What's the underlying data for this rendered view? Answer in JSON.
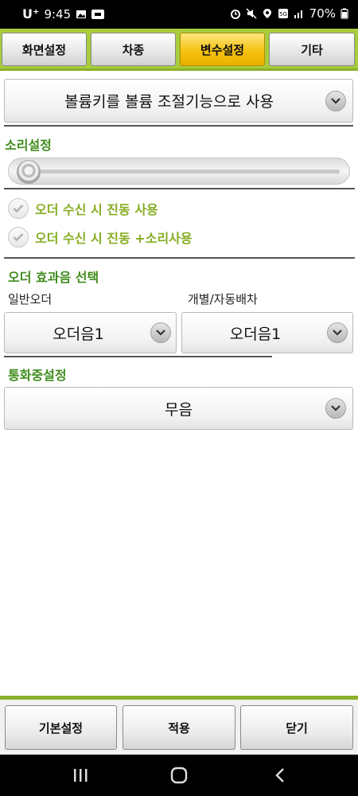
{
  "status_bar": {
    "carrier": "U⁺",
    "time": "9:45",
    "battery": "70%",
    "left_icons": [
      "gallery-icon",
      "notification-badge-icon"
    ],
    "right_icons": [
      "alarm-icon",
      "mute-icon",
      "location-icon",
      "5g-icon",
      "signal-icon",
      "battery-icon"
    ]
  },
  "tabs": [
    {
      "label": "화면설정",
      "active": false
    },
    {
      "label": "차종",
      "active": false
    },
    {
      "label": "변수설정",
      "active": true
    },
    {
      "label": "기타",
      "active": false
    }
  ],
  "volume_key": {
    "selected": "볼륨키를 볼륨 조절기능으로 사용"
  },
  "sound": {
    "title": "소리설정",
    "level": 0.0
  },
  "options": [
    {
      "label": "오더 수신 시 진동 사용",
      "checked": false
    },
    {
      "label": "오더 수신 시 진동 +소리사용",
      "checked": false
    }
  ],
  "order_effect": {
    "title": "오더 효과음 선택",
    "normal_label": "일반오더",
    "normal_value": "오더음1",
    "dispatch_label": "개별/자동배차",
    "dispatch_value": "오더음1"
  },
  "call": {
    "title": "통화중설정",
    "value": "무음"
  },
  "bottom_buttons": {
    "default": "기본설정",
    "apply": "적용",
    "close": "닫기"
  },
  "colors": {
    "accent_green": "#8cb12a",
    "active_tab": "#f6c210",
    "section_title": "#3f8c1c",
    "check_label": "#86ad22"
  }
}
